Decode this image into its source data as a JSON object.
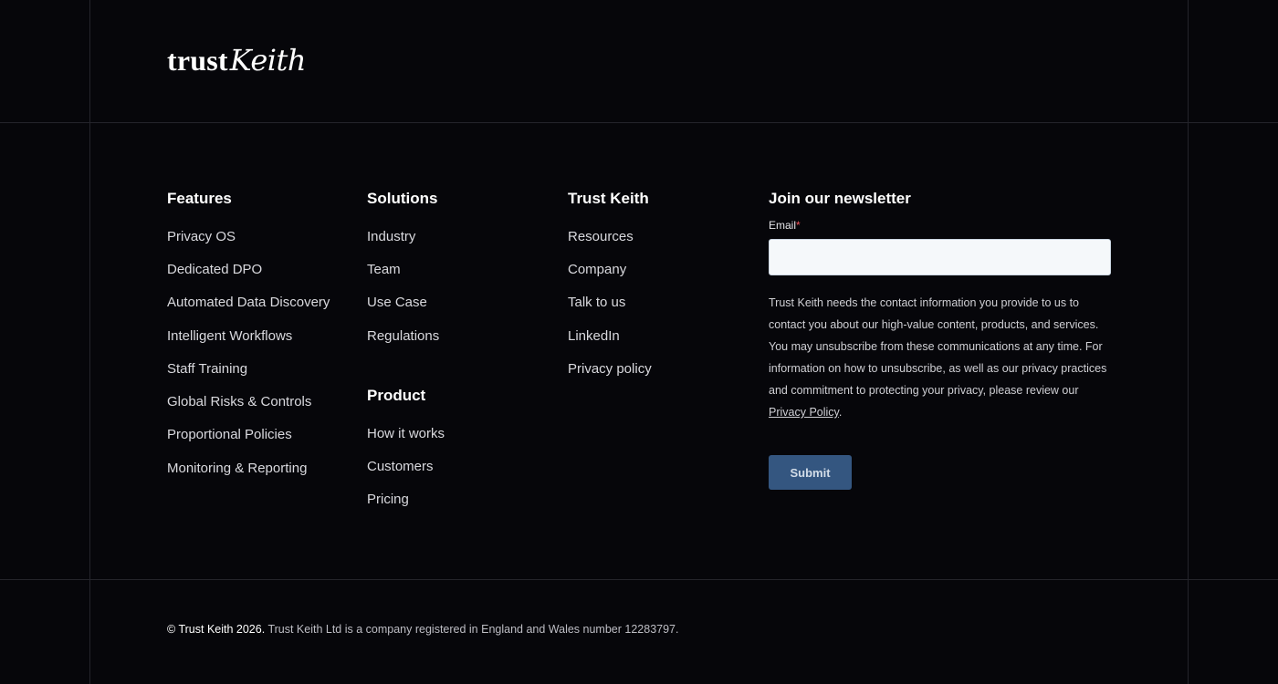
{
  "brand": {
    "logo_trust": "trust",
    "logo_keith": "Keith"
  },
  "columns": {
    "features": {
      "title": "Features",
      "links": [
        "Privacy OS",
        "Dedicated DPO",
        "Automated Data Discovery",
        "Intelligent Workflows",
        "Staff Training",
        "Global Risks & Controls",
        "Proportional Policies",
        "Monitoring & Reporting"
      ]
    },
    "solutions": {
      "title": "Solutions",
      "links": [
        "Industry",
        "Team",
        "Use Case",
        "Regulations"
      ]
    },
    "product": {
      "title": "Product",
      "links": [
        "How it works",
        "Customers",
        "Pricing"
      ]
    },
    "trust_keith": {
      "title": "Trust Keith",
      "links": [
        "Resources",
        "Company",
        "Talk to us",
        "LinkedIn",
        "Privacy policy"
      ]
    }
  },
  "newsletter": {
    "title": "Join our newsletter",
    "email_label": "Email",
    "required_mark": "*",
    "email_value": "",
    "legal_text": "Trust Keith needs the contact information you provide to us to contact you about our high-value content, products, and services. You may unsubscribe from these communications at any time. For information on how to unsubscribe, as well as our privacy practices and commitment to protecting your privacy, please review our",
    "privacy_link": "Privacy Policy",
    "legal_end": ".",
    "submit_label": "Submit"
  },
  "footer": {
    "copyright": "© Trust Keith 2026.",
    "registration": "Trust Keith Ltd is a company registered in England and Wales number 12283797."
  },
  "colors": {
    "background": "#06060a",
    "divider": "#24242b",
    "submit_bg": "#345680",
    "input_bg": "#f5f8fa",
    "required": "#f2545b"
  }
}
